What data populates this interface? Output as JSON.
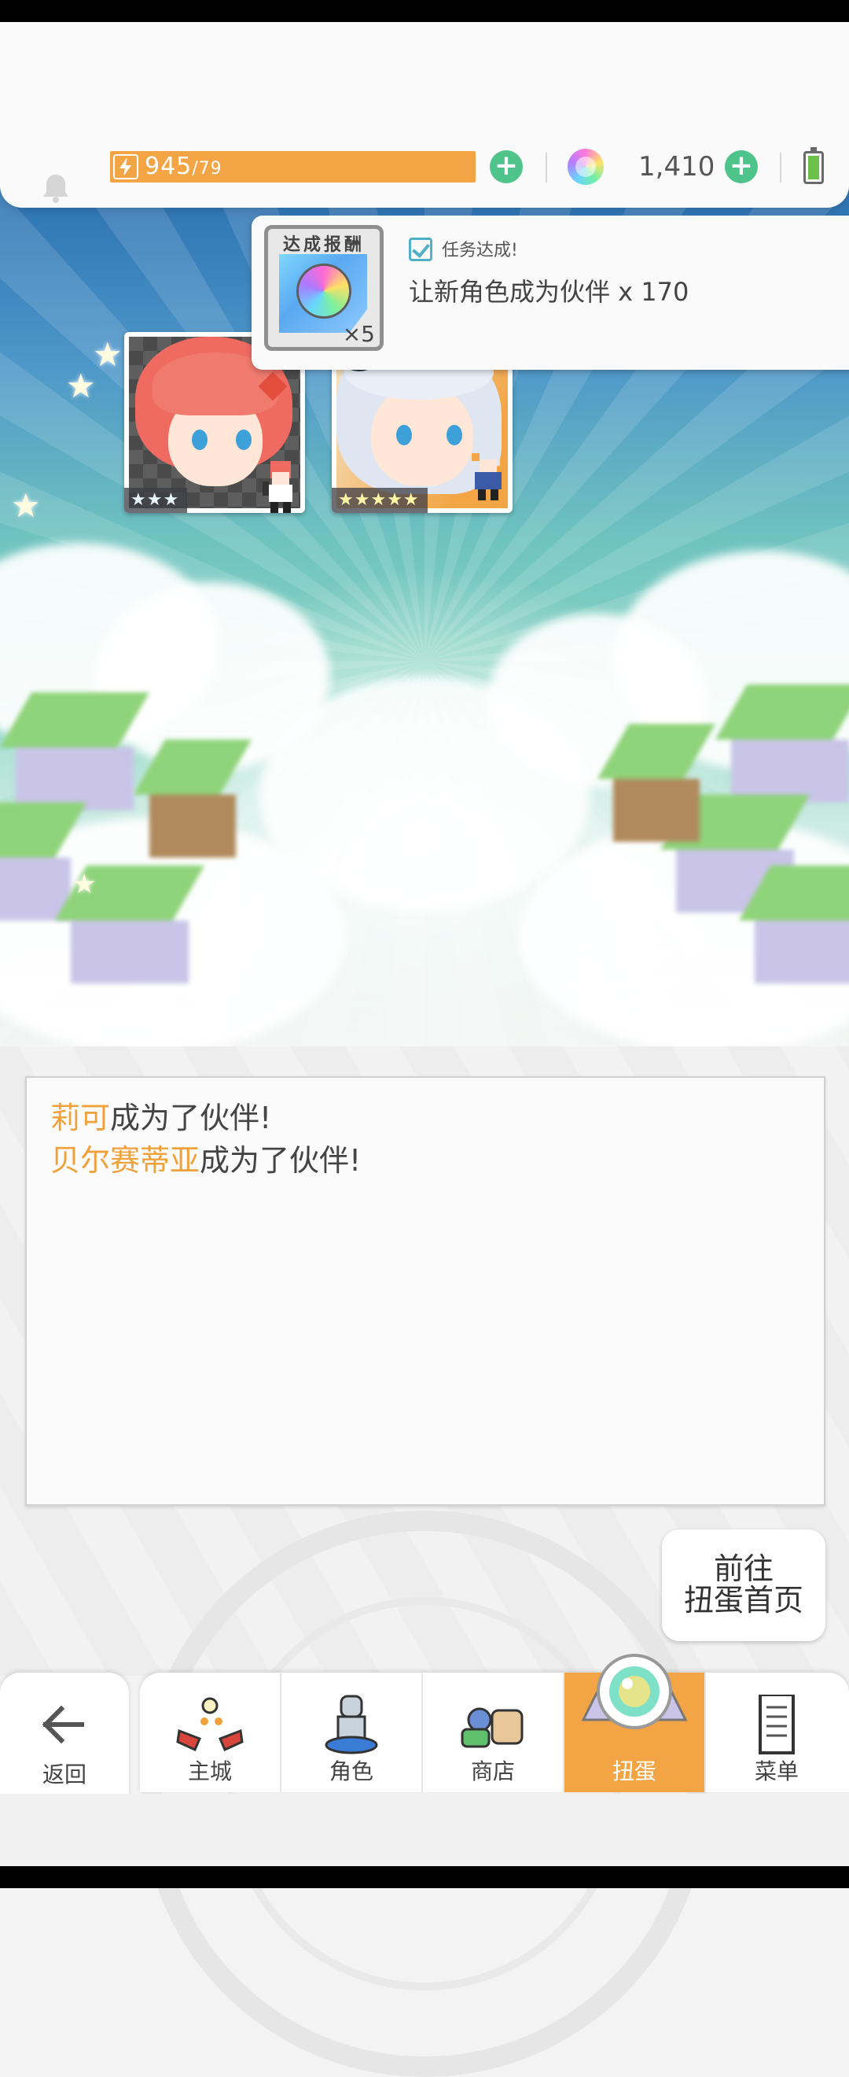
{
  "header": {
    "stamina_current": "945",
    "stamina_max": "/79",
    "gems": "1,410"
  },
  "reward_popup": {
    "card_label": "达成报酬",
    "card_qty": "×5",
    "status": "任务达成!",
    "mission": "让新角色成为伙伴  x 170"
  },
  "characters": [
    {
      "rarity": "★★★"
    },
    {
      "rarity": "★★★★★"
    }
  ],
  "log": {
    "lines": [
      {
        "name": "莉可",
        "text": "成为了伙伴!"
      },
      {
        "name": "贝尔赛蒂亚",
        "text": "成为了伙伴!"
      }
    ]
  },
  "goto_button": {
    "line1": "前往",
    "line2": "扭蛋首页"
  },
  "nav": {
    "back": "返回",
    "items": [
      {
        "label": "主城",
        "icon": "castle-icon"
      },
      {
        "label": "角色",
        "icon": "character-icon"
      },
      {
        "label": "商店",
        "icon": "shop-icon"
      },
      {
        "label": "扭蛋",
        "icon": "gacha-icon",
        "active": true
      },
      {
        "label": "菜单",
        "icon": "menu-icon"
      }
    ]
  },
  "colors": {
    "accent_orange": "#f3a444",
    "plus_green": "#4fc48a",
    "name_orange": "#f0a13a"
  }
}
